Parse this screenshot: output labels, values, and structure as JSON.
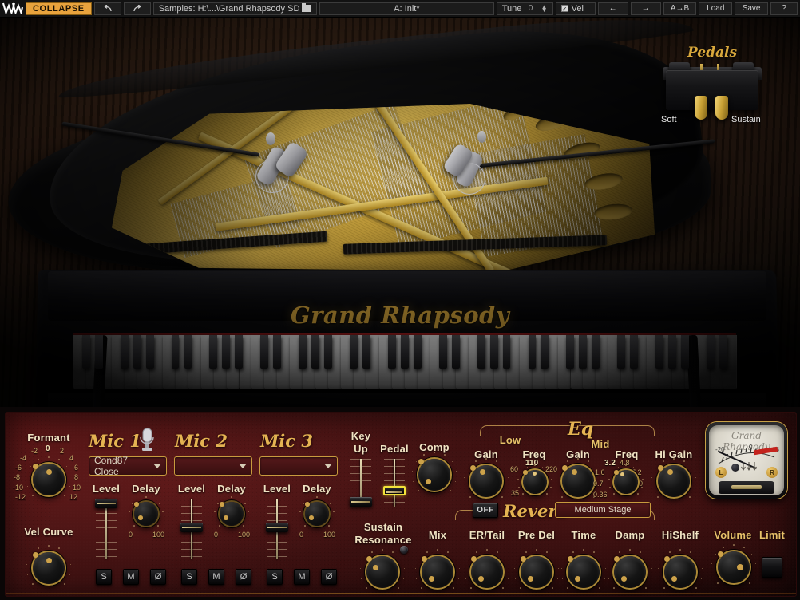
{
  "topbar": {
    "logo": "waves-logo",
    "collapse_label": "COLLAPSE",
    "undo_icon": "undo-icon",
    "redo_icon": "redo-icon",
    "samples_label": "Samples: H:\\...\\Grand Rhapsody SD",
    "folder_icon": "folder-icon",
    "preset_label": "A: Init*",
    "tune_label": "Tune",
    "tune_value": "0",
    "vel_label": "Vel",
    "vel_checked": true,
    "prev_label": "←",
    "next_label": "→",
    "ab_label": "A→B",
    "load_label": "Load",
    "save_label": "Save",
    "help_label": "?"
  },
  "piano": {
    "logo_text": "Grand Rhapsody",
    "pedals": {
      "title": "Pedals",
      "soft_label": "Soft",
      "sustain_label": "Sustain"
    }
  },
  "panel": {
    "formant": {
      "label": "Formant",
      "ticks": [
        "-12",
        "-10",
        "-8",
        "-6",
        "-4",
        "-2",
        "0",
        "2",
        "4",
        "6",
        "8",
        "10",
        "12"
      ],
      "value": "0"
    },
    "vel_curve": {
      "label": "Vel Curve"
    },
    "mics": [
      {
        "title": "Mic 1",
        "icon": "microphone-icon",
        "model": "Cond87 Close",
        "level_label": "Level",
        "delay_label": "Delay",
        "delay_min": "0",
        "delay_max": "100",
        "solo_label": "S",
        "mute_label": "M",
        "phase_label": "Ø"
      },
      {
        "title": "Mic 2",
        "model": "",
        "level_label": "Level",
        "delay_label": "Delay",
        "delay_min": "0",
        "delay_max": "100",
        "solo_label": "S",
        "mute_label": "M",
        "phase_label": "Ø"
      },
      {
        "title": "Mic 3",
        "model": "",
        "level_label": "Level",
        "delay_label": "Delay",
        "delay_min": "0",
        "delay_max": "100",
        "solo_label": "S",
        "mute_label": "M",
        "phase_label": "Ø"
      }
    ],
    "key_up": {
      "label_line1": "Key",
      "label_line2": "Up"
    },
    "pedal": {
      "label": "Pedal",
      "selected": true
    },
    "comp": {
      "label": "Comp"
    },
    "sustain_resonance": {
      "label_line1": "Sustain",
      "label_line2": "Resonance",
      "led": "status-led"
    },
    "eq": {
      "title": "Eq",
      "low_label": "Low",
      "mid_label": "Mid",
      "low_gain_label": "Gain",
      "low_freq_label": "Freq",
      "low_freq_value": "110",
      "low_freq_ticks": [
        "35",
        "60",
        "220"
      ],
      "mid_gain_label": "Gain",
      "mid_freq_label": "Freq",
      "mid_freq_value": "3.2",
      "mid_freq_ticks": [
        "0.36",
        "0.7",
        "1.6",
        "4.8",
        "7.2",
        "10"
      ],
      "hi_gain_label": "Hi Gain"
    },
    "reverb": {
      "power_label": "OFF",
      "title": "Reverb",
      "preset": "Medium Stage",
      "mix_label": "Mix",
      "er_tail_label": "ER/Tail",
      "pre_del_label": "Pre Del",
      "time_label": "Time",
      "damp_label": "Damp",
      "hishelf_label": "HiShelf"
    },
    "output": {
      "volume_label": "Volume",
      "limit_label": "Limit",
      "vu_logo": "Grand Rhapsody",
      "vu_ticks": [
        "-20",
        "0",
        "18"
      ],
      "vu_left": "L",
      "vu_right": "R"
    }
  },
  "colors": {
    "accent_gold": "#e4b352",
    "collapse_orange": "#e8a33d",
    "panel_red": "#4a1414",
    "select_yellow": "#f2e23a"
  }
}
